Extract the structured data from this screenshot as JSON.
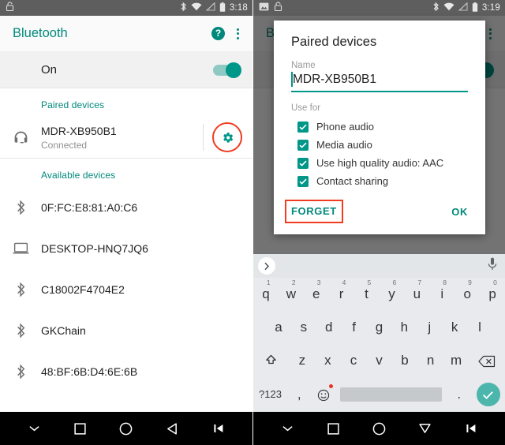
{
  "left": {
    "status_bar": {
      "time": "3:18",
      "icons": [
        "lock-icon",
        "bluetooth-icon",
        "wifi-icon",
        "signal-off-icon",
        "battery-icon"
      ]
    },
    "appbar": {
      "title": "Bluetooth",
      "help_label": "?",
      "overflow_name": "more-options"
    },
    "toggle_row": {
      "label": "On",
      "state": "on"
    },
    "paired_section": {
      "header": "Paired devices"
    },
    "paired_devices": [
      {
        "name": "MDR-XB950B1",
        "status": "Connected",
        "icon": "headset-icon",
        "settings_icon": "gear-icon",
        "highlighted": true
      }
    ],
    "available_section": {
      "header": "Available devices"
    },
    "available_devices": [
      {
        "name": "0F:FC:E8:81:A0:C6",
        "icon": "bluetooth-icon"
      },
      {
        "name": "DESKTOP-HNQ7JQ6",
        "icon": "laptop-icon"
      },
      {
        "name": "C18002F4704E2",
        "icon": "bluetooth-icon"
      },
      {
        "name": "GKChain",
        "icon": "bluetooth-icon"
      },
      {
        "name": "48:BF:6B:D4:6E:6B",
        "icon": "bluetooth-icon"
      }
    ],
    "navbar": [
      "chevron-down-icon",
      "recents-square-icon",
      "home-circle-icon",
      "back-triangle-icon",
      "skip-previous-icon"
    ]
  },
  "right": {
    "status_bar": {
      "time": "3:19",
      "icons": [
        "screenshot-icon",
        "lock-icon",
        "bluetooth-icon",
        "wifi-icon",
        "signal-off-icon",
        "battery-icon"
      ]
    },
    "dialog": {
      "title": "Paired devices",
      "name_label": "Name",
      "name_value": "MDR-XB950B1",
      "use_for_label": "Use for",
      "options": [
        {
          "label": "Phone audio",
          "checked": true
        },
        {
          "label": "Media audio",
          "checked": true
        },
        {
          "label": "Use high quality audio: AAC",
          "checked": true
        },
        {
          "label": "Contact sharing",
          "checked": true
        }
      ],
      "forget_label": "FORGET",
      "ok_label": "OK",
      "forget_highlighted": true
    },
    "keyboard": {
      "expand_icon": "chevron-right-icon",
      "mic_icon": "microphone-icon",
      "row1": [
        {
          "key": "q",
          "num": "1"
        },
        {
          "key": "w",
          "num": "2"
        },
        {
          "key": "e",
          "num": "3"
        },
        {
          "key": "r",
          "num": "4"
        },
        {
          "key": "t",
          "num": "5"
        },
        {
          "key": "y",
          "num": "6"
        },
        {
          "key": "u",
          "num": "7"
        },
        {
          "key": "i",
          "num": "8"
        },
        {
          "key": "o",
          "num": "9"
        },
        {
          "key": "p",
          "num": "0"
        }
      ],
      "row2": [
        "a",
        "s",
        "d",
        "f",
        "g",
        "h",
        "j",
        "k",
        "l"
      ],
      "row3": [
        "z",
        "x",
        "c",
        "v",
        "b",
        "n",
        "m"
      ],
      "shift_icon": "shift-icon",
      "backspace_icon": "backspace-icon",
      "symbols_label": "?123",
      "comma_label": ",",
      "emoji_icon": "emoji-icon",
      "period_label": ".",
      "enter_icon": "check-icon"
    },
    "navbar": [
      "chevron-down-icon",
      "recents-square-icon",
      "home-circle-icon",
      "down-triangle-icon",
      "skip-previous-icon"
    ]
  },
  "colors": {
    "accent": "#00897b",
    "teal": "#009688",
    "highlight": "#f03c20",
    "statusbar": "#5e5e5e"
  }
}
